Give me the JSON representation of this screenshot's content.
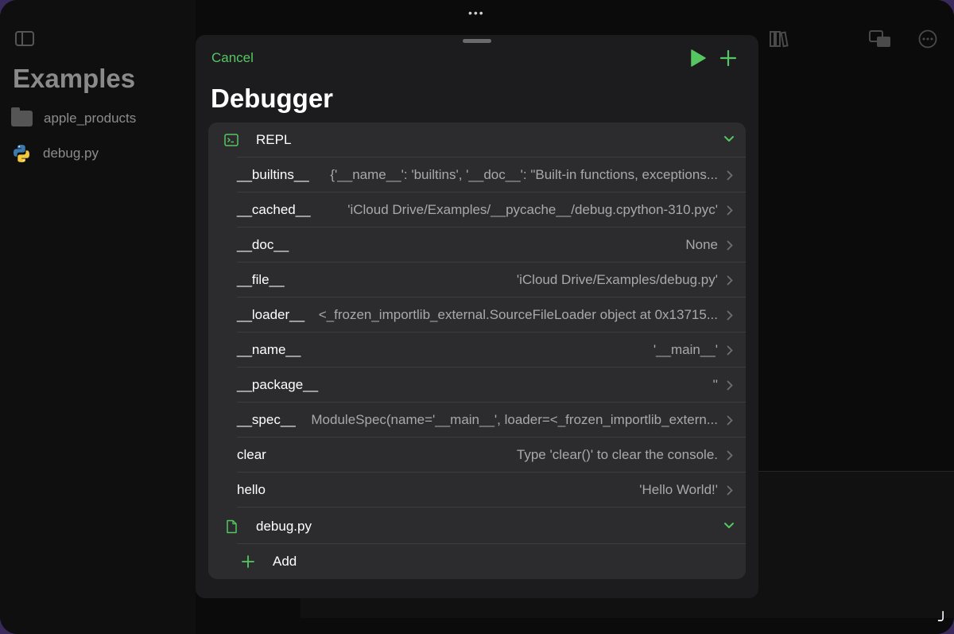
{
  "sidebar": {
    "title": "Examples",
    "items": [
      {
        "label": "apple_products",
        "icon": "folder-icon"
      },
      {
        "label": "debug.py",
        "icon": "python-file-icon"
      }
    ]
  },
  "sheet": {
    "cancel_label": "Cancel",
    "title": "Debugger",
    "accent_color": "#56c760",
    "sections": [
      {
        "label": "REPL",
        "icon": "terminal-icon",
        "expanded": true,
        "variables": [
          {
            "name": "__builtins__",
            "value": "{'__name__': 'builtins', '__doc__': \"Built-in functions, exceptions..."
          },
          {
            "name": "__cached__",
            "value": "'iCloud Drive/Examples/__pycache__/debug.cpython-310.pyc'"
          },
          {
            "name": "__doc__",
            "value": "None"
          },
          {
            "name": "__file__",
            "value": "'iCloud Drive/Examples/debug.py'"
          },
          {
            "name": "__loader__",
            "value": "<_frozen_importlib_external.SourceFileLoader object at 0x13715..."
          },
          {
            "name": "__name__",
            "value": "'__main__'"
          },
          {
            "name": "__package__",
            "value": "''"
          },
          {
            "name": "__spec__",
            "value": "ModuleSpec(name='__main__', loader=<_frozen_importlib_extern..."
          },
          {
            "name": "clear",
            "value": "Type 'clear()' to clear the console."
          },
          {
            "name": "hello",
            "value": "'Hello World!'"
          }
        ]
      },
      {
        "label": "debug.py",
        "icon": "document-icon",
        "expanded": true,
        "variables": []
      }
    ],
    "add_label": "Add"
  }
}
